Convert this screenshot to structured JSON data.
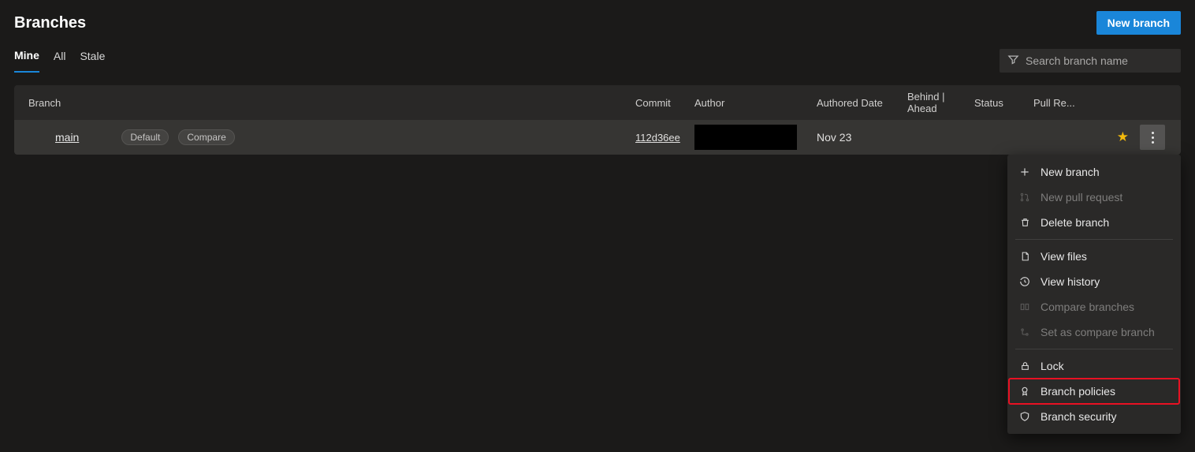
{
  "header": {
    "title": "Branches",
    "new_branch_btn": "New branch"
  },
  "tabs": [
    "Mine",
    "All",
    "Stale"
  ],
  "active_tab_index": 0,
  "search": {
    "placeholder": "Search branch name"
  },
  "columns": {
    "branch": "Branch",
    "commit": "Commit",
    "author": "Author",
    "authored_date": "Authored Date",
    "behind_ahead": "Behind | Ahead",
    "status": "Status",
    "pull_request": "Pull Re..."
  },
  "rows": [
    {
      "name": "main",
      "pills": [
        "Default",
        "Compare"
      ],
      "commit": "112d36ee",
      "author": "",
      "authored_date": "Nov 23"
    }
  ],
  "menu": {
    "new_branch": "New branch",
    "new_pr": "New pull request",
    "delete": "Delete branch",
    "view_files": "View files",
    "view_history": "View history",
    "compare_branches": "Compare branches",
    "set_compare": "Set as compare branch",
    "lock": "Lock",
    "branch_policies": "Branch policies",
    "branch_security": "Branch security"
  }
}
